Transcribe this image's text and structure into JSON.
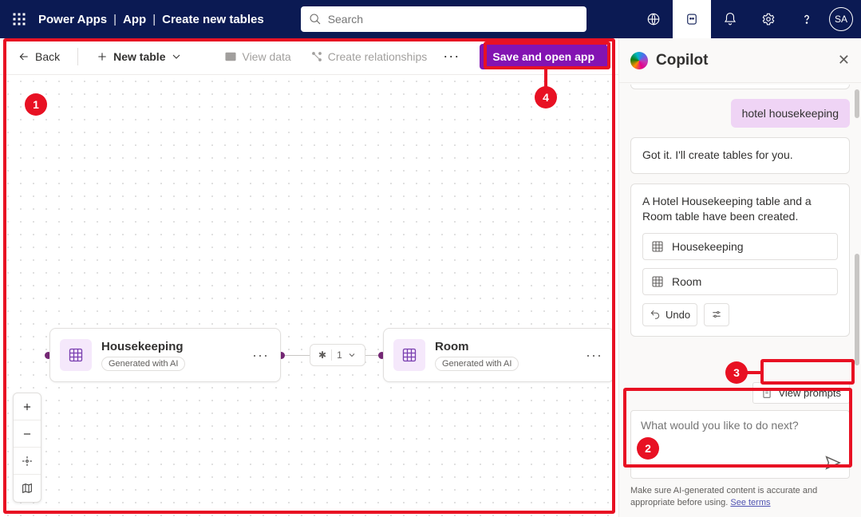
{
  "nav": {
    "app": "Power Apps",
    "crumb2": "App",
    "crumb3": "Create new tables",
    "search_placeholder": "Search",
    "avatar": "SA"
  },
  "toolbar": {
    "back": "Back",
    "new_table": "New table",
    "view_data": "View data",
    "create_rel": "Create relationships",
    "save": "Save and open app"
  },
  "cards": {
    "hk_title": "Housekeeping",
    "hk_badge": "Generated with AI",
    "room_title": "Room",
    "room_badge": "Generated with AI",
    "rel_label": "1"
  },
  "copilot": {
    "title": "Copilot",
    "user_msg": "hotel housekeeping",
    "ai_msg1": "Got it. I'll create tables for you.",
    "ai_msg2": "A Hotel Housekeeping table and a Room table have been created.",
    "chip1": "Housekeeping",
    "chip2": "Room",
    "undo": "Undo",
    "view_prompts": "View prompts",
    "placeholder": "What would you like to do next?",
    "disclaimer_a": "Make sure AI-generated content is accurate and appropriate before using. ",
    "disclaimer_link": "See terms"
  },
  "callouts": {
    "c1": "1",
    "c2": "2",
    "c3": "3",
    "c4": "4"
  }
}
